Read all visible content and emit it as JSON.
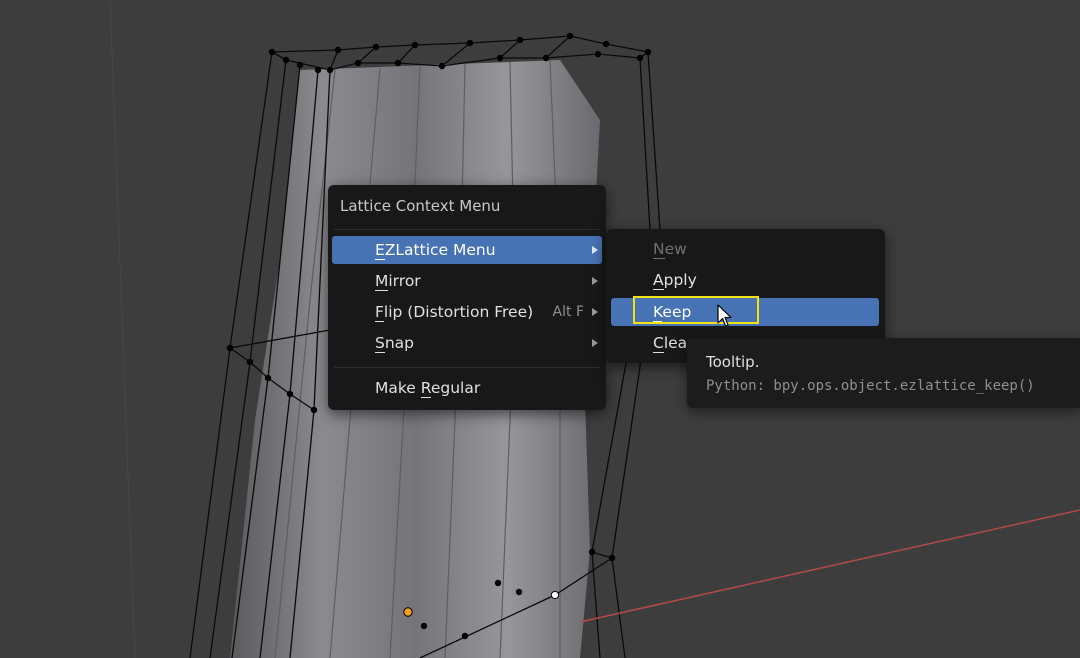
{
  "viewport": {
    "background": "#3d3d3d",
    "mesh_color": "#8b8b90",
    "lattice_color": "#0a0a0a",
    "axis_line_color": "#b34848",
    "selected_vertex_color": "#ffffff",
    "active_vertex_color": "#f5a020"
  },
  "context_menu": {
    "title": "Lattice Context Menu",
    "items": [
      {
        "label_u": "E",
        "label_rest": "ZLattice Menu",
        "shortcut": "",
        "submenu": true,
        "active": true
      },
      {
        "label_u": "M",
        "label_rest": "irror",
        "shortcut": "",
        "submenu": true,
        "active": false
      },
      {
        "label_u": "F",
        "label_rest": "lip (Distortion Free)",
        "shortcut": "Alt F",
        "submenu": true,
        "active": false
      },
      {
        "label_u": "S",
        "label_rest": "nap",
        "shortcut": "",
        "submenu": true,
        "active": false
      }
    ],
    "make_regular": {
      "pre": "Make ",
      "u": "R",
      "post": "egular"
    }
  },
  "submenu": {
    "items": [
      {
        "u": "N",
        "rest": "ew",
        "disabled": true
      },
      {
        "u": "A",
        "rest": "pply",
        "disabled": false
      },
      {
        "u": "K",
        "rest": "eep",
        "active": true
      },
      {
        "u": "C",
        "rest": "lea",
        "disabled": false
      }
    ],
    "accent": "#4772b3",
    "highlight_border": "#f3e312"
  },
  "tooltip": {
    "title": "Tooltip.",
    "python": "Python: bpy.ops.object.ezlattice_keep()"
  }
}
